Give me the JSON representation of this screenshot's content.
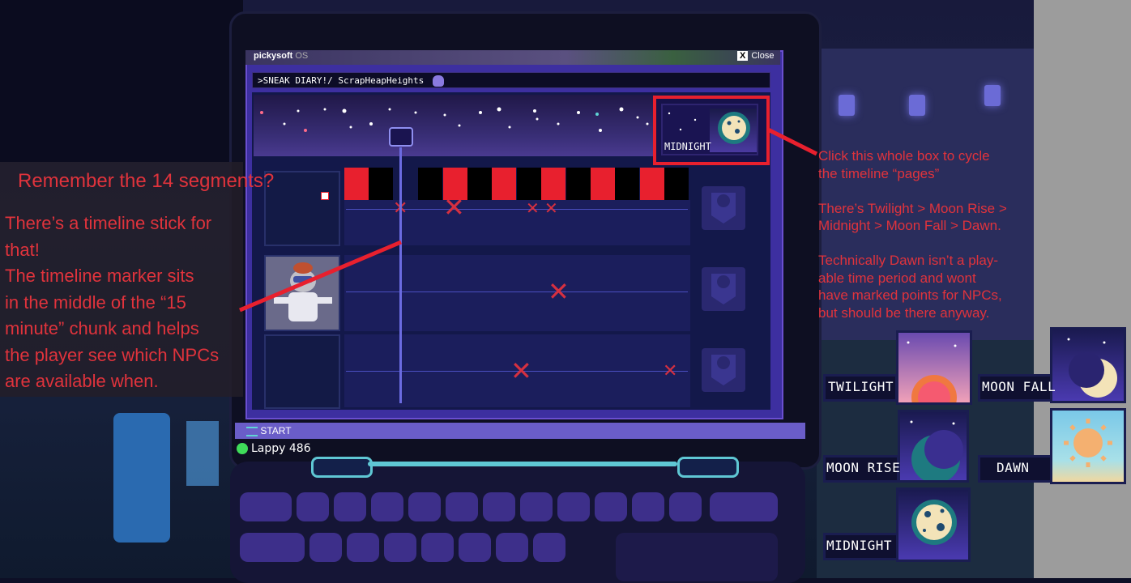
{
  "os": {
    "brand": "pickysoft",
    "brand_suffix": "OS",
    "close_x": "X",
    "close_label": "Close",
    "address": ">SNEAK DIARY!/ ScrapHeapHeights"
  },
  "timeline": {
    "current_page_label": "MIDNIGHT",
    "segments": [
      "red",
      "black",
      "off",
      "black",
      "red",
      "black",
      "red",
      "black",
      "red",
      "black",
      "red",
      "black",
      "red",
      "black"
    ]
  },
  "taskbar": {
    "start_label": "START",
    "device_label": "Lappy 486"
  },
  "notes": {
    "heading": "Remember the 14 segments?",
    "body_lines": [
      "There’s a timeline stick for",
      "that!",
      "The timeline marker sits",
      "in the middle of the “15",
      "minute” chunk and helps",
      "the player see which NPCs",
      "are available when."
    ],
    "right_lines": [
      "Click this whole box to cycle",
      "the timeline “pages”",
      "",
      "There’s Twilight > Moon Rise >",
      "Midnight > Moon Fall > Dawn.",
      "",
      "Technically Dawn isn’t a play-",
      "able time period and wont",
      "have marked points for NPCs,",
      "but should be there anyway."
    ]
  },
  "phases": {
    "twilight": "TWILIGHT",
    "moon_fall": "MOON FALL",
    "moon_rise": "MOON RISE",
    "dawn": "DAWN",
    "midnight": "MIDNIGHT"
  },
  "colors": {
    "accent_red": "#e0333c",
    "segment_red": "#e8202e",
    "os_purple": "#3d2fa0",
    "status_green": "#3fdc5a"
  }
}
